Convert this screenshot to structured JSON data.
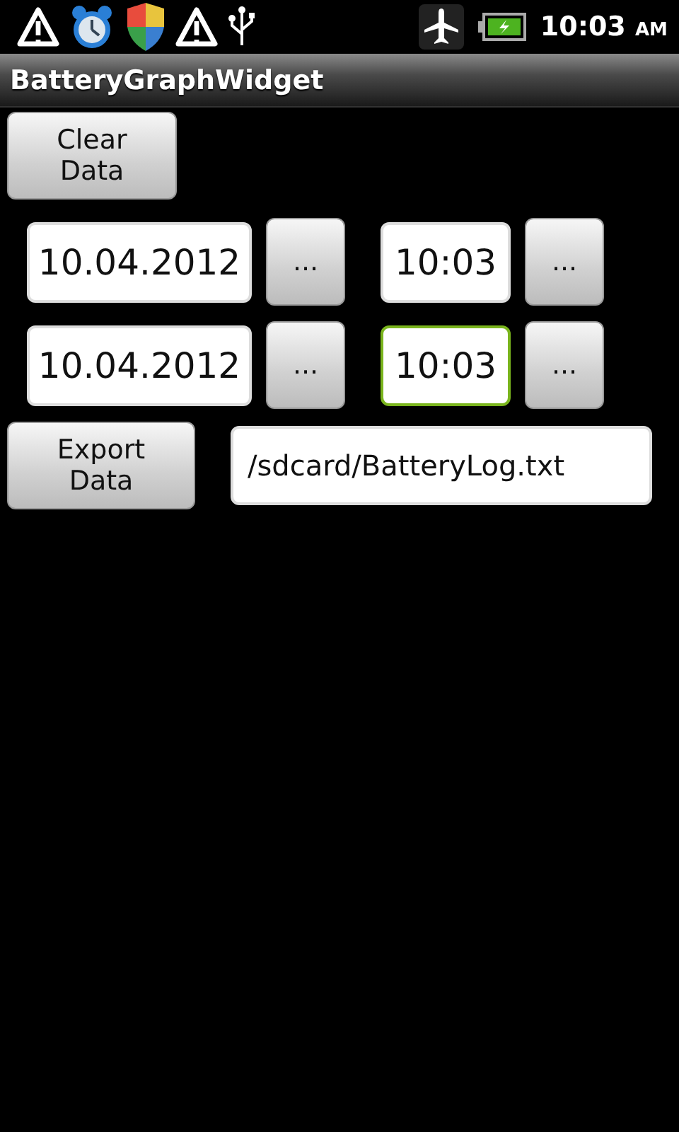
{
  "status_bar": {
    "time": "10:03",
    "ampm": "AM"
  },
  "window": {
    "title": "BatteryGraphWidget"
  },
  "clear_button": "Clear Data",
  "ranges": [
    {
      "date": {
        "value": "10.04.2012",
        "focused": false
      },
      "date_button": "...",
      "time": {
        "value": "10:03",
        "focused": false
      },
      "time_button": "..."
    },
    {
      "date": {
        "value": "10.04.2012",
        "focused": false
      },
      "date_button": "...",
      "time": {
        "value": "10:03",
        "focused": true
      },
      "time_button": "..."
    }
  ],
  "export": {
    "button": "Export Data",
    "path": {
      "value": "/sdcard/BatteryLog.txt",
      "focused": false
    }
  }
}
